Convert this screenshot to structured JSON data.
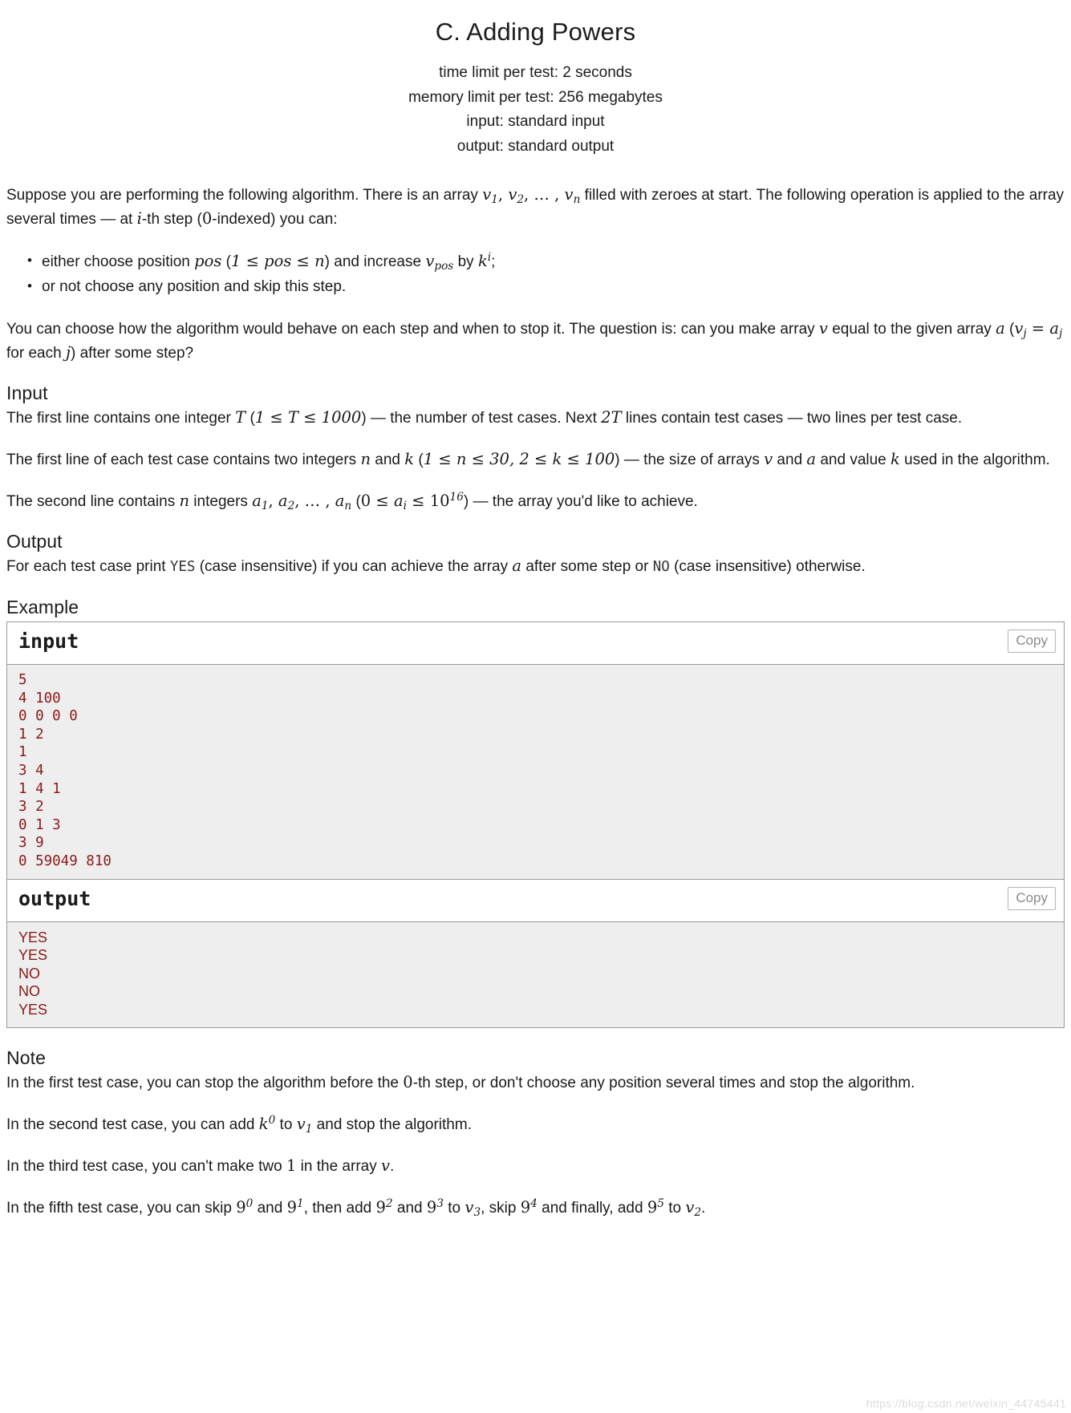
{
  "header": {
    "title": "C. Adding Powers",
    "time_limit": "time limit per test: 2 seconds",
    "memory_limit": "memory limit per test: 256 megabytes",
    "input_file": "input: standard input",
    "output_file": "output: standard output"
  },
  "legend": {
    "p1_a": "Suppose you are performing the following algorithm. There is an array ",
    "p1_v1": "v",
    "p1_v1_sub": "1",
    "p1_c1": ", ",
    "p1_v2": "v",
    "p1_v2_sub": "2",
    "p1_c2": ", … , ",
    "p1_vn": "v",
    "p1_vn_sub": "n",
    "p1_b": " filled with zeroes at start. The following operation is applied to the array several times — at ",
    "p1_i": "i",
    "p1_c": "-th step (",
    "p1_zero": "0",
    "p1_d": "-indexed) you can:",
    "bullet1_a": "either choose position ",
    "bullet1_pos": "pos",
    "bullet1_b": " (",
    "bullet1_ineq": "1 ≤ pos ≤ n",
    "bullet1_c": ") and increase ",
    "bullet1_v": "v",
    "bullet1_v_sub": "pos",
    "bullet1_d": " by ",
    "bullet1_k": "k",
    "bullet1_k_sup": "i",
    "bullet1_e": ";",
    "bullet2": "or not choose any position and skip this step.",
    "p2_a": "You can choose how the algorithm would behave on each step and when to stop it. The question is: can you make array ",
    "p2_v": "v",
    "p2_b": " equal to the given array ",
    "p2_a2": "a",
    "p2_c": " (",
    "p2_vj": "v",
    "p2_vj_sub": "j",
    "p2_eq": " = ",
    "p2_aj": "a",
    "p2_aj_sub": "j",
    "p2_d": " for each ",
    "p2_j": "j",
    "p2_e": ") after some step?"
  },
  "input_section": {
    "heading": "Input",
    "p1_a": "The first line contains one integer ",
    "p1_T": "T",
    "p1_b": " (",
    "p1_ineq": "1 ≤ T ≤ 1000",
    "p1_c": ") — the number of test cases. Next ",
    "p1_2T": "2T",
    "p1_d": " lines contain test cases — two lines per test case.",
    "p2_a": "The first line of each test case contains two integers ",
    "p2_n": "n",
    "p2_and": " and ",
    "p2_k": "k",
    "p2_b": " (",
    "p2_ineq": "1 ≤ n ≤ 30, 2 ≤ k ≤ 100",
    "p2_c": ") — the size of arrays ",
    "p2_v": "v",
    "p2_and2": " and ",
    "p2_a2": "a",
    "p2_d": " and value ",
    "p2_k2": "k",
    "p2_e": " used in the algorithm.",
    "p3_a": "The second line contains ",
    "p3_n": "n",
    "p3_b": " integers ",
    "p3_a1": "a",
    "p3_a1_sub": "1",
    "p3_c1": ", ",
    "p3_a2": "a",
    "p3_a2_sub": "2",
    "p3_c2": ", … , ",
    "p3_an": "a",
    "p3_an_sub": "n",
    "p3_c": " (",
    "p3_ineq_a": "0 ≤ ",
    "p3_ai": "a",
    "p3_ai_sub": "i",
    "p3_ineq_b": " ≤ ",
    "p3_ten": "10",
    "p3_ten_sup": "16",
    "p3_d": ") — the array you'd like to achieve."
  },
  "output_section": {
    "heading": "Output",
    "p1_a": "For each test case print ",
    "yes": "YES",
    "p1_b": " (case insensitive) if you can achieve the array ",
    "p1_a2": "a",
    "p1_c": " after some step or ",
    "no": "NO",
    "p1_d": " (case insensitive) otherwise."
  },
  "example": {
    "heading": "Example",
    "input_label": "input",
    "output_label": "output",
    "copy_label": "Copy",
    "input_text": "5\n4 100\n0 0 0 0\n1 2\n1\n3 4\n1 4 1\n3 2\n0 1 3\n3 9\n0 59049 810",
    "output_text": "YES\nYES\nNO\nNO\nYES"
  },
  "note_section": {
    "heading": "Note",
    "n1_a": "In the first test case, you can stop the algorithm before the ",
    "n1_zero": "0",
    "n1_b": "-th step, or don't choose any position several times and stop the algorithm.",
    "n2_a": "In the second test case, you can add ",
    "n2_k": "k",
    "n2_k_sup": "0",
    "n2_b": " to ",
    "n2_v": "v",
    "n2_v_sub": "1",
    "n2_c": " and stop the algorithm.",
    "n3_a": "In the third test case, you can't make two ",
    "n3_one": "1",
    "n3_b": " in the array ",
    "n3_v": "v",
    "n3_c": ".",
    "n5_a": "In the fifth test case, you can skip ",
    "n5_p0": "9",
    "n5_p0_sup": "0",
    "n5_b": " and ",
    "n5_p1": "9",
    "n5_p1_sup": "1",
    "n5_c": ", then add ",
    "n5_p2": "9",
    "n5_p2_sup": "2",
    "n5_d": " and ",
    "n5_p3": "9",
    "n5_p3_sup": "3",
    "n5_e": " to ",
    "n5_v3": "v",
    "n5_v3_sub": "3",
    "n5_f": ", skip ",
    "n5_p4": "9",
    "n5_p4_sup": "4",
    "n5_g": " and finally, add ",
    "n5_p5": "9",
    "n5_p5_sup": "5",
    "n5_h": " to ",
    "n5_v2": "v",
    "n5_v2_sub": "2",
    "n5_i": "."
  },
  "watermark": {
    "text": "https://blog.csdn.net/weixin_44745441"
  }
}
